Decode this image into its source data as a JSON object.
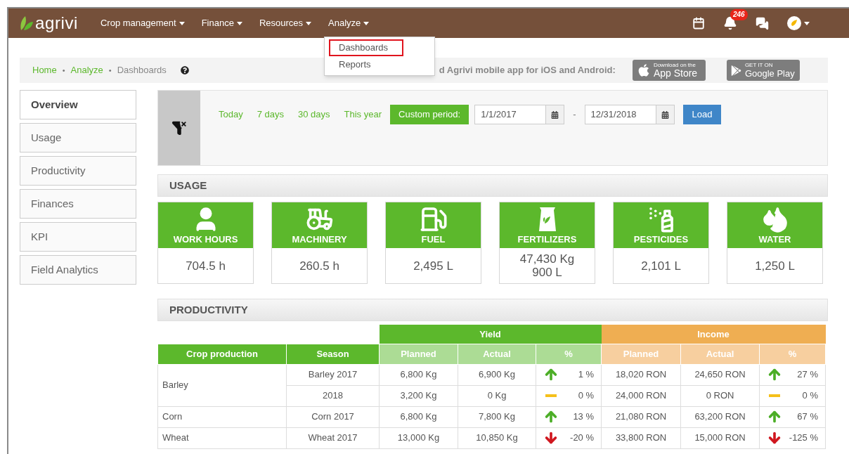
{
  "navbar": {
    "logo": "agrivi",
    "menus": [
      "Crop management",
      "Finance",
      "Resources",
      "Analyze"
    ],
    "notification_count": "246"
  },
  "dropdown": {
    "items": [
      {
        "label": "Dashboards",
        "selected": true
      },
      {
        "label": "Reports",
        "selected": false
      }
    ]
  },
  "breadcrumb": {
    "separator": "•",
    "items": [
      {
        "label": "Home",
        "kind": "link"
      },
      {
        "label": "Analyze",
        "kind": "link"
      },
      {
        "label": "Dashboards",
        "kind": "current"
      }
    ]
  },
  "mobile_banner": {
    "text": "d Agrivi mobile app for iOS and Android:",
    "app_store": {
      "small": "Download on the",
      "big": "App Store"
    },
    "google_play": {
      "small": "GET IT ON",
      "big": "Google Play"
    }
  },
  "sidebar": {
    "items": [
      {
        "label": "Overview",
        "selected": true
      },
      {
        "label": "Usage",
        "selected": false
      },
      {
        "label": "Productivity",
        "selected": false
      },
      {
        "label": "Finances",
        "selected": false
      },
      {
        "label": "KPI",
        "selected": false
      },
      {
        "label": "Field Analytics",
        "selected": false
      }
    ]
  },
  "period_filter": {
    "options": [
      {
        "label": "Today",
        "selected": false
      },
      {
        "label": "7 days",
        "selected": false
      },
      {
        "label": "30 days",
        "selected": false
      },
      {
        "label": "This year",
        "selected": false
      },
      {
        "label": "Custom period:",
        "selected": true
      }
    ],
    "from": "1/1/2017",
    "separator": "-",
    "to": "12/31/2018",
    "load_button": "Load"
  },
  "usage": {
    "title": "USAGE",
    "tiles": [
      {
        "kind": "person",
        "label": "WORK HOURS",
        "values": [
          "704.5 h"
        ]
      },
      {
        "kind": "tractor",
        "label": "MACHINERY",
        "values": [
          "260.5 h"
        ]
      },
      {
        "kind": "fuel",
        "label": "FUEL",
        "values": [
          "2,495 L"
        ]
      },
      {
        "kind": "bag",
        "label": "FERTILIZERS",
        "values": [
          "47,430 Kg",
          "900 L"
        ]
      },
      {
        "kind": "spray",
        "label": "PESTICIDES",
        "values": [
          "2,101 L"
        ]
      },
      {
        "kind": "water",
        "label": "WATER",
        "values": [
          "1,250 L"
        ]
      }
    ]
  },
  "productivity": {
    "title": "PRODUCTIVITY",
    "groups": [
      "Yield",
      "Income"
    ],
    "columns": [
      "Crop production",
      "Season",
      "Planned",
      "Actual",
      "%",
      "Planned",
      "Actual",
      "%"
    ],
    "crops": [
      {
        "crop": "Barley",
        "seasons": [
          {
            "season": "Barley 2017",
            "yield": {
              "planned": "6,800 Kg",
              "actual": "6,900 Kg",
              "kind": "up",
              "percent": "1 %"
            },
            "income": {
              "planned": "18,020 RON",
              "actual": "24,650 RON",
              "kind": "up",
              "percent": "27 %"
            }
          },
          {
            "season": "2018",
            "yield": {
              "planned": "3,200 Kg",
              "actual": "0 Kg",
              "kind": "flat",
              "percent": "0 %"
            },
            "income": {
              "planned": "24,000 RON",
              "actual": "0 RON",
              "kind": "flat",
              "percent": "0 %"
            }
          }
        ]
      },
      {
        "crop": "Corn",
        "seasons": [
          {
            "season": "Corn 2017",
            "yield": {
              "planned": "6,800 Kg",
              "actual": "7,800 Kg",
              "kind": "up",
              "percent": "13 %"
            },
            "income": {
              "planned": "21,080 RON",
              "actual": "63,200 RON",
              "kind": "up",
              "percent": "67 %"
            }
          }
        ]
      },
      {
        "crop": "Wheat",
        "seasons": [
          {
            "season": "Wheat 2017",
            "yield": {
              "planned": "13,000 Kg",
              "actual": "10,850 Kg",
              "kind": "down",
              "percent": "-20 %"
            },
            "income": {
              "planned": "33,800 RON",
              "actual": "15,000 RON",
              "kind": "down",
              "percent": "-125 %"
            }
          }
        ]
      }
    ]
  }
}
